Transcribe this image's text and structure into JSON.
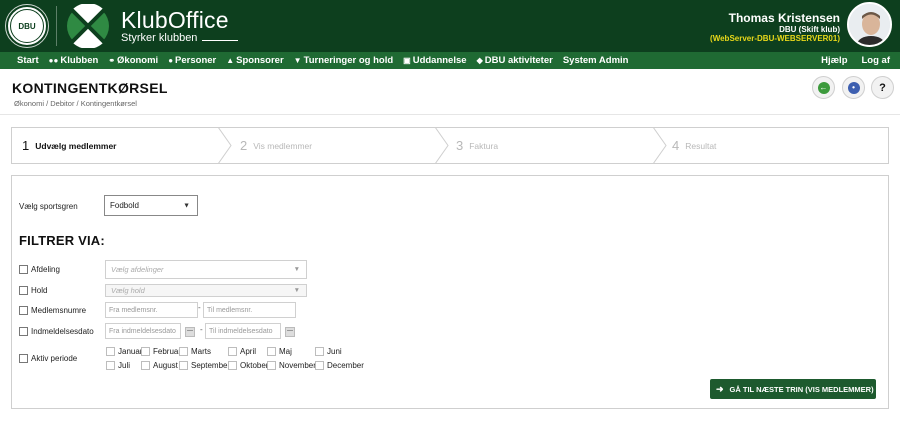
{
  "header": {
    "dbu_logo_text": "DBU",
    "app_title": "KlubOffice",
    "app_subtitle": "Styrker klubben",
    "user_name": "Thomas Kristensen",
    "user_club": "DBU (Skift klub)",
    "user_server": "(WebServer-DBU-WEBSERVER01)"
  },
  "nav": {
    "items": [
      {
        "label": "Start",
        "icon": "none"
      },
      {
        "label": "Klubben",
        "icon": "people-icon"
      },
      {
        "label": "Økonomi",
        "icon": "coin-icon"
      },
      {
        "label": "Personer",
        "icon": "person-icon"
      },
      {
        "label": "Sponsorer",
        "icon": "sponsor-icon"
      },
      {
        "label": "Turneringer og hold",
        "icon": "trophy-icon"
      },
      {
        "label": "Uddannelse",
        "icon": "screen-icon"
      },
      {
        "label": "DBU aktiviteter",
        "icon": "cap-icon"
      },
      {
        "label": "System Admin",
        "icon": "none"
      }
    ],
    "right": {
      "help": "Hjælp",
      "logout": "Log af"
    }
  },
  "page": {
    "title": "KONTINGENTKØRSEL",
    "breadcrumb": "Økonomi / Debitor / Kontingentkørsel"
  },
  "wizard": {
    "steps": [
      {
        "num": "1",
        "label": "Udvælg medlemmer",
        "active": true
      },
      {
        "num": "2",
        "label": "Vis medlemmer",
        "active": false
      },
      {
        "num": "3",
        "label": "Faktura",
        "active": false
      },
      {
        "num": "4",
        "label": "Resultat",
        "active": false
      }
    ]
  },
  "form": {
    "sport_label": "Vælg sportsgren",
    "sport_value": "Fodbold",
    "filter_heading": "FILTRER VIA:",
    "afdeling_label": "Afdeling",
    "afdeling_placeholder": "Vælg afdelinger",
    "hold_label": "Hold",
    "hold_placeholder": "Vælg hold",
    "medlemsnumre_label": "Medlemsnumre",
    "from_member_placeholder": "Fra medlemsnr.",
    "to_member_placeholder": "Til medlemsnr.",
    "indmeldelse_label": "Indmeldelsesdato",
    "from_date_placeholder": "Fra indmeldelsesdato",
    "to_date_placeholder": "Til indmeldelsesdato",
    "aktiv_label": "Aktiv periode",
    "dash": "-",
    "months": [
      "Januar",
      "Februar",
      "Marts",
      "April",
      "Maj",
      "Juni",
      "Juli",
      "August",
      "September",
      "Oktober",
      "November",
      "December"
    ],
    "next_button": "GÅ TIL NÆSTE TRIN (VIS MEDLEMMER)"
  },
  "colors": {
    "header_bg": "#0d3f1e",
    "nav_bg": "#1f6a33",
    "server_text": "#e8d81a",
    "button_bg": "#1d5a2e"
  }
}
